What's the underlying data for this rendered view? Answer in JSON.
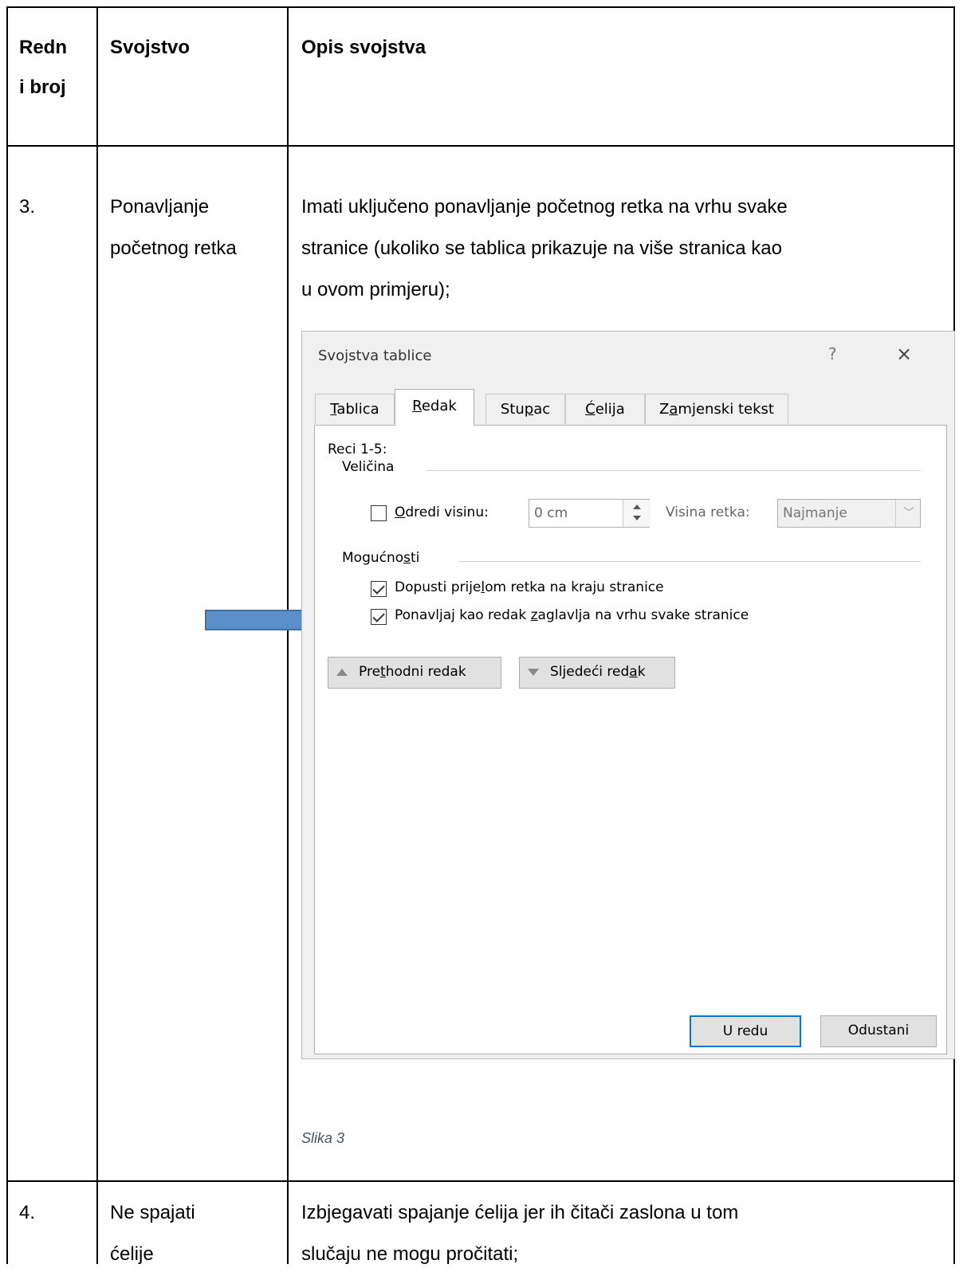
{
  "table": {
    "headers": {
      "col1": "Redn i broj",
      "col1_line1": "Redn",
      "col1_line2": "i broj",
      "col2": "Svojstvo",
      "col3": "Opis svojstva"
    },
    "rows": [
      {
        "number": "3.",
        "property_line1": "Ponavljanje",
        "property_line2": "početnog retka",
        "desc_line1": "Imati uključeno ponavljanje početnog retka na vrhu svake",
        "desc_line2": "stranice (ukoliko se tablica prikazuje na više stranica kao",
        "desc_line3": "u ovom primjeru);",
        "caption": "Slika 3"
      },
      {
        "number": "4.",
        "property_line1": "Ne spajati",
        "property_line2": "ćelije",
        "desc_line1": "Izbjegavati spajanje ćelija jer ih čitači zaslona u tom",
        "desc_line2": "slučaju ne mogu pročitati;"
      }
    ]
  },
  "dialog": {
    "title": "Svojstva tablice",
    "help": "?",
    "close": "×",
    "tabs": [
      {
        "label": "Tablica",
        "active": false
      },
      {
        "label": "Redak",
        "active": true
      },
      {
        "label": "Stupac",
        "active": false
      },
      {
        "label": "Ćelija",
        "active": false
      },
      {
        "label": "Zamjenski tekst",
        "active": false
      }
    ],
    "rows_label": "Reci 1-5:",
    "size_group": "Veličina",
    "specify_height_label": "Odredi visinu:",
    "specify_height_checked": false,
    "height_value": "0 cm",
    "row_height_label": "Visina retka:",
    "row_height_value": "Najmanje",
    "options_group": "Mogućnosti",
    "option1": {
      "label": "Dopusti prijelom retka na kraju stranice",
      "checked": true
    },
    "option2": {
      "label": "Ponavljaj kao redak zaglavlja na vrhu svake stranice",
      "checked": true
    },
    "prev_row": "Prethodni redak",
    "next_row": "Sljedeći redak",
    "ok": "U redu",
    "cancel": "Odustani"
  },
  "colors": {
    "arrow": "#5b8fc9",
    "arrow_border": "#41719c",
    "caption": "#44546a",
    "primary_button_border": "#0078d7"
  }
}
